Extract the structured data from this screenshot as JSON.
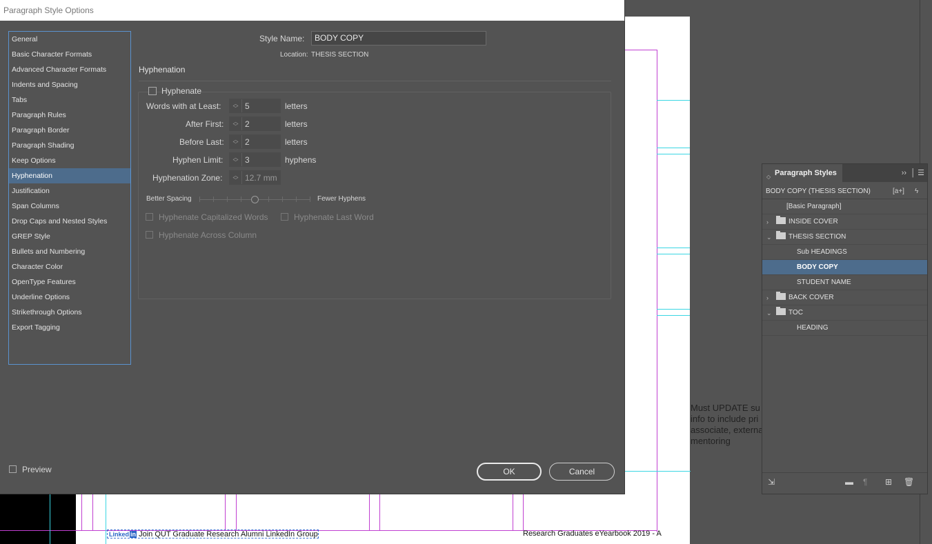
{
  "dialog": {
    "title": "Paragraph Style Options",
    "style_name_label": "Style Name:",
    "style_name_value": "BODY COPY",
    "location_label": "Location:",
    "location_value": "THESIS SECTION",
    "section_title": "Hyphenation",
    "categories": [
      "General",
      "Basic Character Formats",
      "Advanced Character Formats",
      "Indents and Spacing",
      "Tabs",
      "Paragraph Rules",
      "Paragraph Border",
      "Paragraph Shading",
      "Keep Options",
      "Hyphenation",
      "Justification",
      "Span Columns",
      "Drop Caps and Nested Styles",
      "GREP Style",
      "Bullets and Numbering",
      "Character Color",
      "OpenType Features",
      "Underline Options",
      "Strikethrough Options",
      "Export Tagging"
    ],
    "selected_category": "Hyphenation",
    "hyphenate_label": "Hyphenate",
    "hyphenate_checked": false,
    "fields": {
      "words_label": "Words with at Least:",
      "words_value": "5",
      "words_unit": "letters",
      "after_label": "After First:",
      "after_value": "2",
      "after_unit": "letters",
      "before_label": "Before Last:",
      "before_value": "2",
      "before_unit": "letters",
      "limit_label": "Hyphen Limit:",
      "limit_value": "3",
      "limit_unit": "hyphens",
      "zone_label": "Hyphenation Zone:",
      "zone_value": "12.7 mm"
    },
    "slider": {
      "left_label": "Better Spacing",
      "right_label": "Fewer Hyphens",
      "position": 0.5
    },
    "options": {
      "caps": "Hyphenate Capitalized Words",
      "last_word": "Hyphenate Last Word",
      "across_column": "Hyphenate Across Column"
    },
    "preview_label": "Preview",
    "ok_label": "OK",
    "cancel_label": "Cancel"
  },
  "panel": {
    "title": "Paragraph Styles",
    "current_style": "BODY COPY (THESIS SECTION)",
    "new_style_icon": "[a+]",
    "items": [
      {
        "label": "[Basic Paragraph]",
        "type": "style",
        "indent": 1
      },
      {
        "label": "INSIDE COVER",
        "type": "folder",
        "expanded": false
      },
      {
        "label": "THESIS SECTION",
        "type": "folder",
        "expanded": true
      },
      {
        "label": "Sub HEADINGS",
        "type": "style",
        "indent": 2
      },
      {
        "label": "BODY COPY",
        "type": "style",
        "indent": 2,
        "selected": true
      },
      {
        "label": "STUDENT NAME",
        "type": "style",
        "indent": 2
      },
      {
        "label": "BACK COVER",
        "type": "folder",
        "expanded": false
      },
      {
        "label": "TOC",
        "type": "folder",
        "expanded": true
      },
      {
        "label": "HEADING",
        "type": "style",
        "indent": 2
      }
    ]
  },
  "canvas": {
    "note_lines": [
      "Must UPDATE su",
      "info to include pri",
      "associate, externa",
      "mentoring"
    ],
    "footer_left_logo": "Linked",
    "footer_left_logo_in": "in",
    "footer_left": "Join QUT Graduate Research Alumni LinkedIn Group",
    "footer_right": "Research Graduates eYearbook 2019 - A"
  }
}
